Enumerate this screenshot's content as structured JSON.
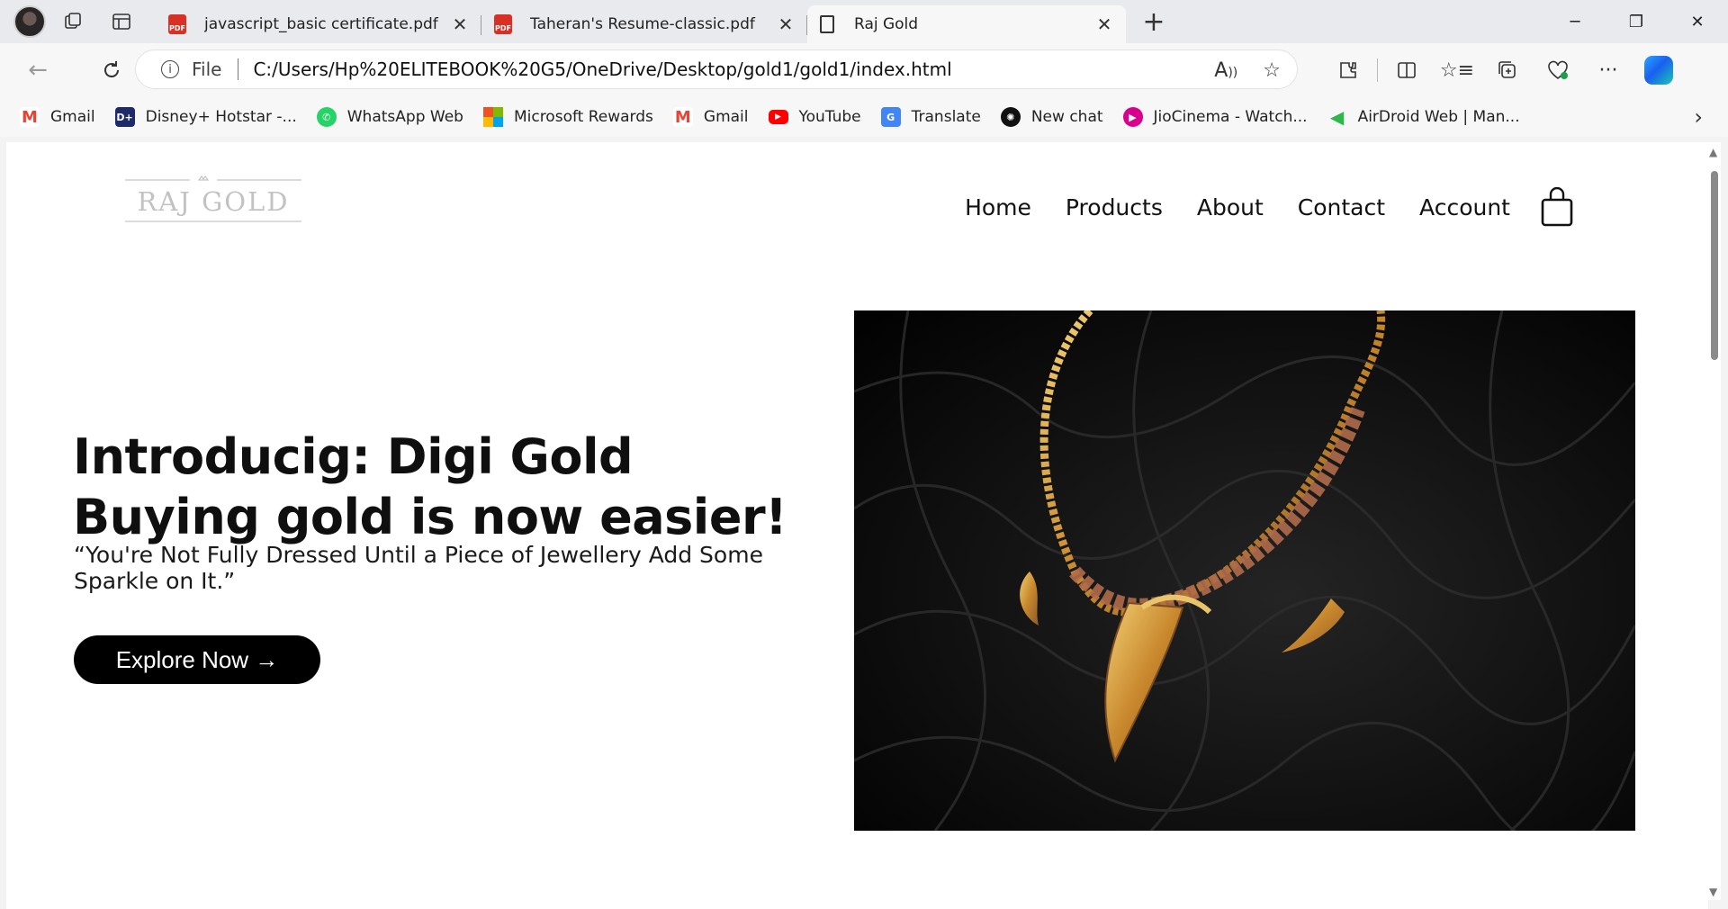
{
  "browser": {
    "tabs": [
      {
        "title": "javascript_basic certificate.pdf",
        "type": "pdf"
      },
      {
        "title": "Taheran's Resume-classic.pdf",
        "type": "pdf"
      },
      {
        "title": "Raj Gold",
        "type": "page",
        "active": true
      }
    ],
    "address": {
      "scheme_label": "File",
      "url": "C:/Users/Hp%20ELITEBOOK%20G5/OneDrive/Desktop/gold1/gold1/index.html"
    },
    "bookmarks": [
      {
        "label": "Gmail",
        "icon": "gmail-icon",
        "color": "#ea4335"
      },
      {
        "label": "Disney+ Hotstar -...",
        "icon": "hotstar-icon",
        "color": "#1f2a6b"
      },
      {
        "label": "WhatsApp Web",
        "icon": "whatsapp-icon",
        "color": "#25d366"
      },
      {
        "label": "Microsoft Rewards",
        "icon": "microsoft-icon",
        "color": "#f25022"
      },
      {
        "label": "Gmail",
        "icon": "gmail-icon",
        "color": "#ea4335"
      },
      {
        "label": "YouTube",
        "icon": "youtube-icon",
        "color": "#ff0000"
      },
      {
        "label": "Translate",
        "icon": "translate-icon",
        "color": "#4285f4"
      },
      {
        "label": "New chat",
        "icon": "chatgpt-icon",
        "color": "#111111"
      },
      {
        "label": "JioCinema - Watch...",
        "icon": "jiocinema-icon",
        "color": "#d9008d"
      },
      {
        "label": "AirDroid Web | Man...",
        "icon": "airdroid-icon",
        "color": "#2db84b"
      }
    ]
  },
  "site": {
    "logo_text": "RAJ GOLD",
    "nav": [
      "Home",
      "Products",
      "About",
      "Contact",
      "Account"
    ],
    "hero": {
      "line1": "Introducig: Digi Gold",
      "line2": "Buying gold is now easier!",
      "quote": "“You're Not Fully Dressed Until a Piece of Jewellery Add Some Sparkle on It.”",
      "cta": "Explore Now →"
    }
  }
}
